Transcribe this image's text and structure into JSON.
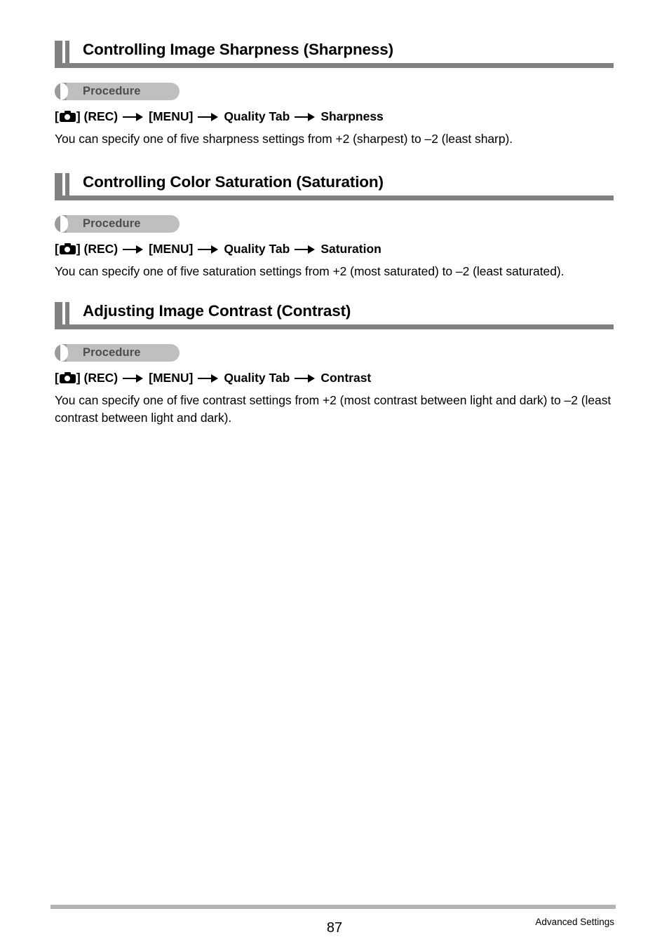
{
  "document": {
    "sections": [
      {
        "heading": "Controlling Image Sharpness (Sharpness)",
        "procedure_label": "Procedure",
        "path": {
          "bracket_open": "[",
          "icon": "camera-icon",
          "bracket_close": "] (REC)",
          "step2": "[MENU]",
          "step3": "Quality Tab",
          "step4": "Sharpness"
        },
        "body": "You can specify one of five sharpness settings from +2 (sharpest) to –2 (least sharp)."
      },
      {
        "heading": "Controlling Color Saturation (Saturation)",
        "procedure_label": "Procedure",
        "path": {
          "bracket_open": "[",
          "icon": "camera-icon",
          "bracket_close": "] (REC)",
          "step2": "[MENU]",
          "step3": "Quality Tab",
          "step4": "Saturation"
        },
        "body": "You can specify one of five saturation settings from +2 (most saturated) to –2 (least saturated)."
      },
      {
        "heading": "Adjusting Image Contrast (Contrast)",
        "procedure_label": "Procedure",
        "path": {
          "bracket_open": "[",
          "icon": "camera-icon",
          "bracket_close": "] (REC)",
          "step2": "[MENU]",
          "step3": "Quality Tab",
          "step4": "Contrast"
        },
        "body": "You can specify one of five contrast settings from +2 (most contrast between light and dark) to –2 (least contrast between light and dark)."
      }
    ]
  },
  "footer": {
    "page_number": "87",
    "section_label": "Advanced Settings"
  },
  "colors": {
    "heading_marker": "#808080",
    "heading_rule": "#808080",
    "badge_background": "#bfbfbf",
    "badge_bar": "#9a9a9a",
    "badge_text": "#4d4d4d",
    "footer_rule": "#b3b3b3",
    "text": "#000000"
  }
}
